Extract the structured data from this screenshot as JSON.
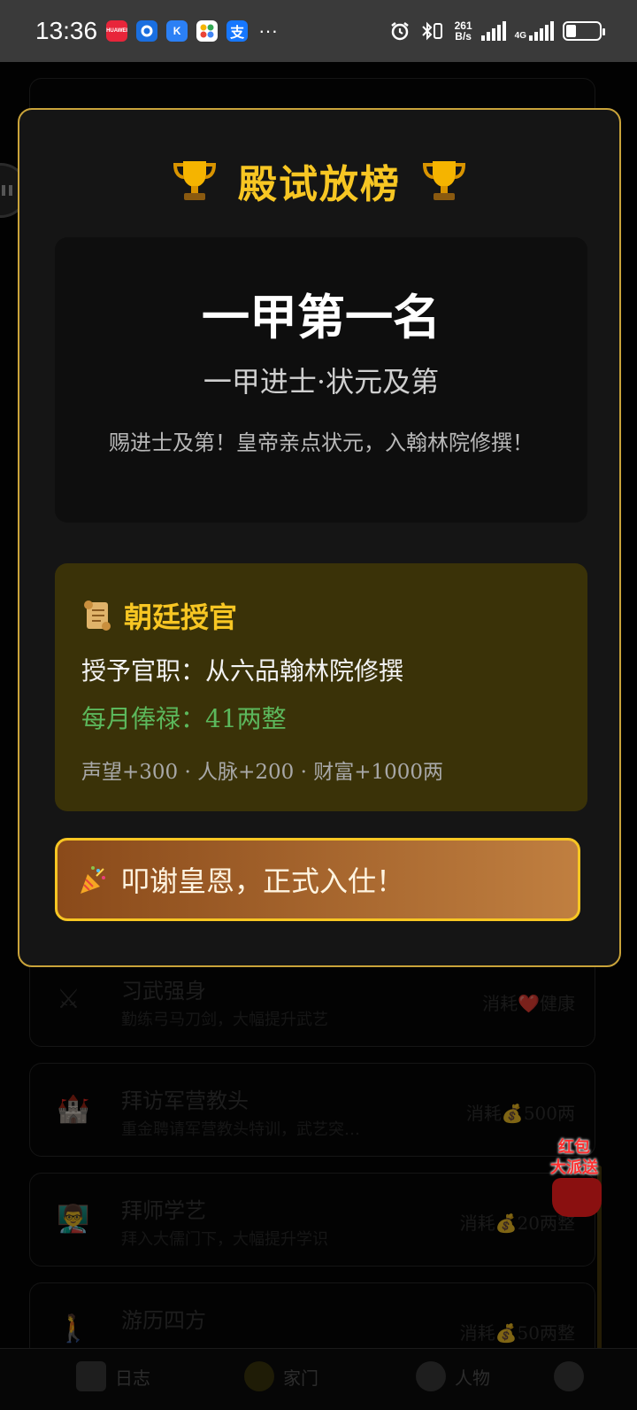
{
  "status_bar": {
    "time": "13:36",
    "app_badges": [
      "HUAWEI",
      "",
      "K",
      "",
      "支"
    ],
    "more": "···",
    "net_speed_value": "261",
    "net_speed_unit": "B/s",
    "network": "4G",
    "battery_percent": 30
  },
  "modal": {
    "title": "殿试放榜",
    "rank_title": "一甲第一名",
    "rank_subtitle": "一甲进士·状元及第",
    "rank_description": "赐进士及第！皇帝亲点状元，入翰林院修撰！",
    "appointment": {
      "header": "朝廷授官",
      "office": "授予官职：从六品翰林院修撰",
      "salary": "每月俸禄：41两整",
      "rewards": "声望+300 · 人脉+200 · 财富+1000两"
    },
    "confirm_label": "叩谢皇恩，正式入仕！"
  },
  "background_list": [
    {
      "title": "习武强身",
      "desc": "勤练弓马刀剑，大幅提升武艺",
      "cost": "消耗❤️健康"
    },
    {
      "title": "拜访军营教头",
      "desc": "重金聘请军营教头特训，武艺突…",
      "cost": "消耗💰500两"
    },
    {
      "title": "拜师学艺",
      "desc": "拜入大儒门下，大幅提升学识",
      "cost": "消耗💰20两整"
    },
    {
      "title": "游历四方",
      "desc": "",
      "cost": "消耗💰50两整"
    }
  ],
  "red_packet": {
    "line1": "红包",
    "line2": "大派送"
  },
  "tab_bar": [
    {
      "label": "日志"
    },
    {
      "label": "家门"
    },
    {
      "label": "人物"
    },
    {
      "label": ""
    }
  ],
  "colors": {
    "accent_gold": "#f7c623",
    "salary_green": "#5cb85c",
    "appointment_bg": "#3a3208"
  }
}
